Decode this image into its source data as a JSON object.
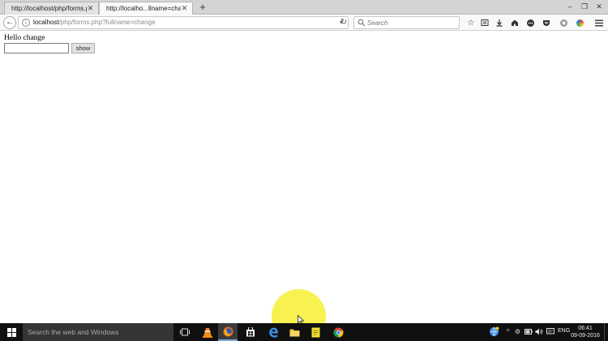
{
  "tabs": [
    {
      "label": "http://localhost/php/forms.php",
      "active": false
    },
    {
      "label": "http://localho...llname=change",
      "active": true
    }
  ],
  "urlbar": {
    "host": "localhost",
    "path": "/php/forms.php?fullname=change"
  },
  "search": {
    "placeholder": "Search"
  },
  "page": {
    "greeting": "Hello change",
    "input_value": "",
    "button_label": "show"
  },
  "taskbar": {
    "search_placeholder": "Search the web and Windows",
    "language": "ENG",
    "time": "06:41",
    "date": "09-09-2016"
  },
  "colors": {
    "cursor_highlight": "#f6f043",
    "taskbar": "#101010",
    "tabstrip": "#d4d4d4"
  }
}
